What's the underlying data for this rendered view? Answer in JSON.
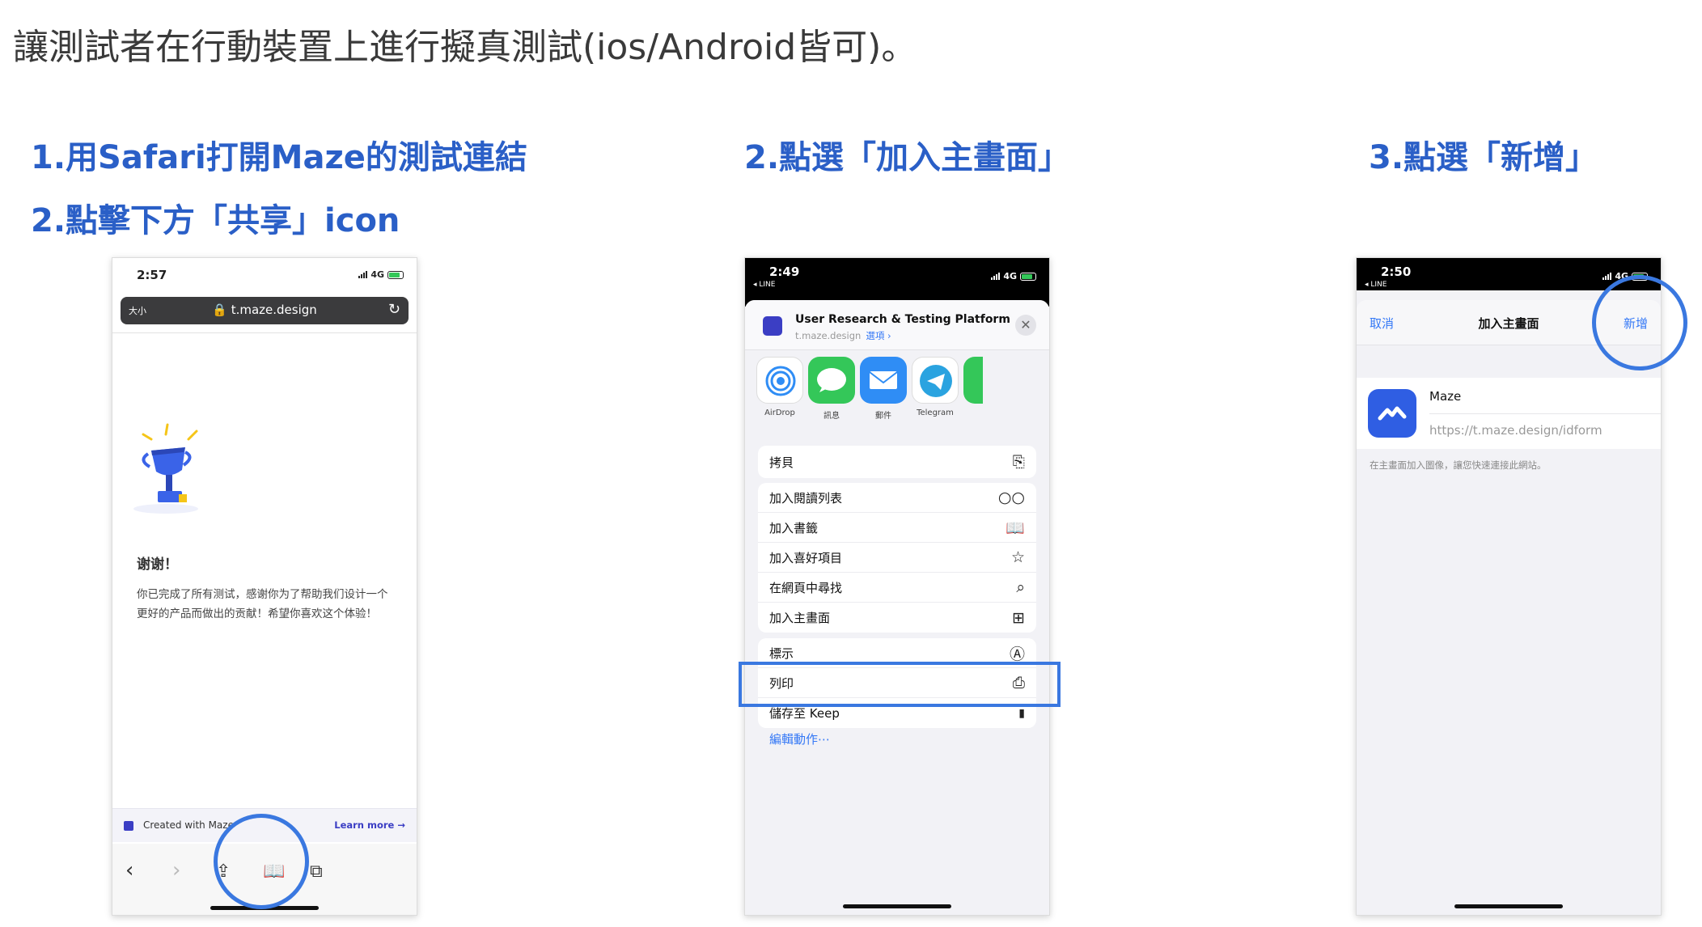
{
  "intro": "讓測試者在行動裝置上進行擬真測試(ios/Android皆可)。",
  "steps": {
    "step1_line1": "1.用Safari打開Maze的測試連結",
    "step1_line2": "2.點擊下方「共享」icon",
    "step2": "2.點選「加入主畫面」",
    "step3": "3.點選「新增」"
  },
  "phone1": {
    "time": "2:57",
    "network": "4G",
    "text_size": "大小",
    "url": "t.maze.design",
    "thanks": "谢谢！",
    "body": "你已完成了所有测试，感谢你为了帮助我们设计一个更好的产品而做出的贡献！希望你喜欢这个体验！",
    "banner_created": "Created with Maze",
    "banner_learn": "Learn more →",
    "toolbar_icons": [
      "back-icon",
      "forward-icon",
      "share-icon",
      "bookmarks-icon",
      "tabs-icon"
    ]
  },
  "phone2": {
    "time": "2:49",
    "back_app": "◂ LINE",
    "network": "4G",
    "site_title": "User Research & Testing Platform",
    "site_url": "t.maze.design",
    "site_options": "選項 ›",
    "apps": [
      {
        "label": "AirDrop",
        "color": "#ffffff"
      },
      {
        "label": "訊息",
        "color": "#34c759"
      },
      {
        "label": "郵件",
        "color": "#2f8df5"
      },
      {
        "label": "Telegram",
        "color": "#2aa3e0"
      }
    ],
    "copy": {
      "label": "拷貝",
      "icon": "copy-icon"
    },
    "actions": [
      {
        "label": "加入閱讀列表",
        "icon": "glasses-icon",
        "glyph": "○○"
      },
      {
        "label": "加入書籤",
        "icon": "book-icon",
        "glyph": "📖"
      },
      {
        "label": "加入喜好項目",
        "icon": "star-icon",
        "glyph": "☆"
      },
      {
        "label": "在網頁中尋找",
        "icon": "search-icon",
        "glyph": "⌕"
      },
      {
        "label": "加入主畫面",
        "icon": "add-square-icon",
        "glyph": "⊞"
      }
    ],
    "actions2": [
      {
        "label": "標示",
        "icon": "markup-icon",
        "glyph": "Ⓐ"
      },
      {
        "label": "列印",
        "icon": "print-icon",
        "glyph": "⎙"
      },
      {
        "label": "儲存至 Keep",
        "icon": "bookmark-icon",
        "glyph": "▮"
      }
    ],
    "edit_actions": "編輯動作⋯"
  },
  "phone3": {
    "time": "2:50",
    "back_app": "◂ LINE",
    "network": "4G",
    "cancel": "取消",
    "title": "加入主畫面",
    "add": "新增",
    "app_name": "Maze",
    "app_url": "https://t.maze.design/idform",
    "hint": "在主畫面加入圖像，讓您快速連接此網站。"
  },
  "colors": {
    "accent": "#2a5fc7",
    "highlight": "#3a78e0",
    "ios_blue": "#3478f6",
    "maze_blue": "#2f5ee3"
  }
}
